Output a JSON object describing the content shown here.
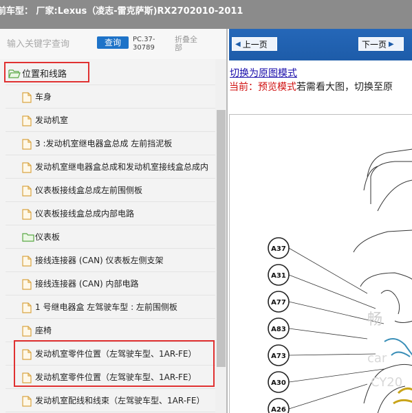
{
  "window": {
    "title": "前车型：  厂家:Lexus（凌志-雷克萨斯)RX2702010-2011"
  },
  "search": {
    "placeholder": "输入关键字查询",
    "query_label": "查询",
    "pc_code": "PC.37-30789",
    "collapse_label": "折叠全部"
  },
  "tree": [
    {
      "label": "位置和线路",
      "level": 0,
      "icon": "folder-open-icon"
    },
    {
      "label": "车身",
      "level": 1,
      "icon": "document-icon"
    },
    {
      "label": "发动机室",
      "level": 1,
      "icon": "document-icon"
    },
    {
      "label": "3 :发动机室继电器盒总成 左前挡泥板",
      "level": 1,
      "icon": "document-icon"
    },
    {
      "label": "发动机室继电器盒总成和发动机室接线盒总成内",
      "level": 1,
      "icon": "document-icon"
    },
    {
      "label": "仪表板接线盒总成左前围侧板",
      "level": 1,
      "icon": "document-icon"
    },
    {
      "label": "仪表板接线盒总成内部电路",
      "level": 1,
      "icon": "document-icon"
    },
    {
      "label": "仪表板",
      "level": 1,
      "icon": "folder-icon"
    },
    {
      "label": "接线连接器 (CAN) 仪表板左侧支架",
      "level": 1,
      "icon": "document-icon"
    },
    {
      "label": "接线连接器 (CAN) 内部电路",
      "level": 1,
      "icon": "document-icon"
    },
    {
      "label": "1 号继电器盒 左驾驶车型 : 左前围侧板",
      "level": 1,
      "icon": "document-icon"
    },
    {
      "label": "座椅",
      "level": 1,
      "icon": "document-icon"
    },
    {
      "label": "发动机室零件位置（左驾驶车型、1AR-FE）",
      "level": 1,
      "icon": "document-icon"
    },
    {
      "label": "发动机室零件位置（左驾驶车型、1AR-FE）",
      "level": 1,
      "icon": "document-icon"
    },
    {
      "label": "发动机室配线和线束（左驾驶车型、1AR-FE）",
      "level": 1,
      "icon": "document-icon"
    }
  ],
  "viewer": {
    "prev_label": "上一页",
    "next_label": "下一页",
    "toggle_link": "切换为原图模式",
    "mode_current": "当前：预览模式",
    "mode_hint": "若需看大图，切换至原",
    "connectors": [
      "A37",
      "A31",
      "A77",
      "A83",
      "A73",
      "A30",
      "A26"
    ],
    "watermark_lines": [
      "畅",
      "car",
      "CY20"
    ]
  },
  "colors": {
    "accent_blue": "#1e73c8",
    "nav_blue": "#1d5ca9",
    "highlight_red": "#e03030",
    "link": "#1a0dab",
    "mode_red": "#d01010"
  }
}
